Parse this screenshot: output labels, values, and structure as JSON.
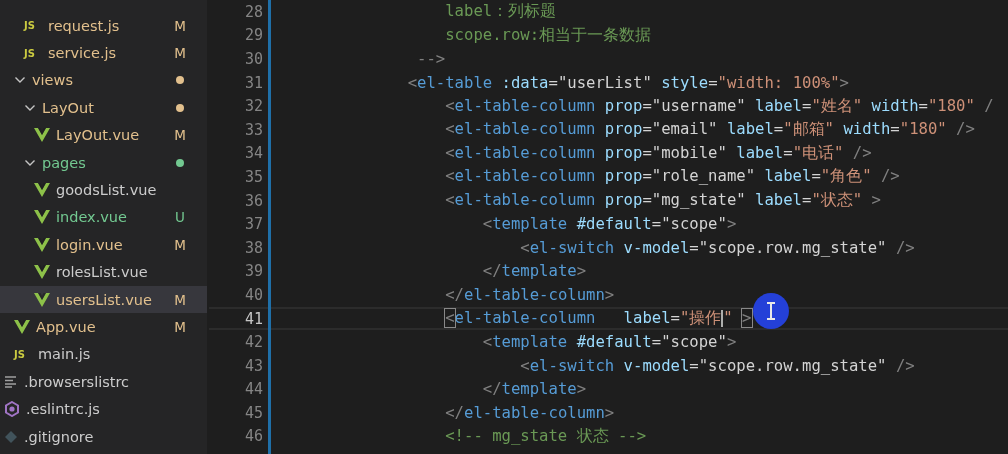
{
  "explorer": {
    "items": [
      {
        "children": [
          {
            "children": [
              {
                "name": "request.js",
                "kind": "js",
                "icon_label": "JS",
                "color": "#e2c08d",
                "badge": "M",
                "selected": false
              },
              {
                "name": "service.js",
                "kind": "js",
                "icon_label": "JS",
                "color": "#e2c08d",
                "badge": "M",
                "selected": false
              }
            ]
          },
          {
            "name": "views",
            "kind": "folder",
            "color": "#e2c08d",
            "expanded": true,
            "selected": false,
            "children": [
              {
                "name": "LayOut",
                "kind": "folder",
                "color": "#e2c08d",
                "expanded": true,
                "selected": false,
                "children": [
                  {
                    "name": "LayOut.vue",
                    "kind": "vue",
                    "color": "#e2c08d",
                    "badge": "M",
                    "selected": false
                  }
                ]
              },
              {
                "name": "pages",
                "kind": "folder",
                "color": "#73c991",
                "expanded": true,
                "selected": false,
                "children": [
                  {
                    "name": "goodsList.vue",
                    "kind": "vue",
                    "selected": false
                  },
                  {
                    "name": "index.vue",
                    "kind": "vue",
                    "color": "#73c991",
                    "badge": "U",
                    "selected": false
                  },
                  {
                    "name": "login.vue",
                    "kind": "vue",
                    "color": "#e2c08d",
                    "badge": "M",
                    "selected": false
                  },
                  {
                    "name": "rolesList.vue",
                    "kind": "vue",
                    "selected": false
                  },
                  {
                    "name": "usersList.vue",
                    "kind": "vue",
                    "color": "#e2c08d",
                    "badge": "M",
                    "selected": true
                  }
                ]
              }
            ]
          },
          {
            "name": "App.vue",
            "kind": "vue",
            "color": "#e2c08d",
            "badge": "M",
            "selected": false
          },
          {
            "name": "main.js",
            "kind": "js",
            "icon_label": "JS",
            "selected": false
          }
        ]
      },
      {
        "name": ".browserslistrc",
        "kind": "config",
        "selected": false
      },
      {
        "name": ".eslintrc.js",
        "kind": "eslint",
        "selected": false
      },
      {
        "name": ".gitignore",
        "kind": "git",
        "selected": false
      }
    ]
  },
  "editor": {
    "lines": [
      {
        "number": "28",
        "current": false,
        "tokens": [
          {
            "kind": "comment",
            "text": "                label：列标题"
          }
        ]
      },
      {
        "number": "29",
        "current": false,
        "tokens": [
          {
            "kind": "comment",
            "text": "                scope.row:相当于一条数据"
          }
        ]
      },
      {
        "number": "30",
        "current": false,
        "tokens": [
          {
            "kind": "punct",
            "text": "             -->"
          }
        ]
      },
      {
        "number": "31",
        "current": false,
        "tokens": [
          {
            "kind": "punct",
            "text": "            <"
          },
          {
            "kind": "tag",
            "text": "el-table"
          },
          {
            "kind": "attr",
            "text": " :data"
          },
          {
            "kind": "plain",
            "text": "=\"userList\" "
          },
          {
            "kind": "attr",
            "text": "style"
          },
          {
            "kind": "plain",
            "text": "="
          },
          {
            "kind": "string",
            "text": "\"width: 100%\""
          },
          {
            "kind": "punct",
            "text": ">"
          }
        ]
      },
      {
        "number": "32",
        "current": false,
        "tokens": [
          {
            "kind": "punct",
            "text": "                <"
          },
          {
            "kind": "tag",
            "text": "el-table-column"
          },
          {
            "kind": "attr",
            "text": " prop"
          },
          {
            "kind": "plain",
            "text": "=\"username\" "
          },
          {
            "kind": "attr",
            "text": "label"
          },
          {
            "kind": "plain",
            "text": "="
          },
          {
            "kind": "string",
            "text": "\"姓名\""
          },
          {
            "kind": "attr",
            "text": " width"
          },
          {
            "kind": "plain",
            "text": "="
          },
          {
            "kind": "string",
            "text": "\"180\""
          },
          {
            "kind": "punct",
            "text": " /"
          }
        ]
      },
      {
        "number": "33",
        "current": false,
        "tokens": [
          {
            "kind": "punct",
            "text": "                <"
          },
          {
            "kind": "tag",
            "text": "el-table-column"
          },
          {
            "kind": "attr",
            "text": " prop"
          },
          {
            "kind": "plain",
            "text": "=\"email\" "
          },
          {
            "kind": "attr",
            "text": "label"
          },
          {
            "kind": "plain",
            "text": "="
          },
          {
            "kind": "string",
            "text": "\"邮箱\""
          },
          {
            "kind": "attr",
            "text": " width"
          },
          {
            "kind": "plain",
            "text": "="
          },
          {
            "kind": "string",
            "text": "\"180\""
          },
          {
            "kind": "punct",
            "text": " />"
          }
        ]
      },
      {
        "number": "34",
        "current": false,
        "tokens": [
          {
            "kind": "punct",
            "text": "                <"
          },
          {
            "kind": "tag",
            "text": "el-table-column"
          },
          {
            "kind": "attr",
            "text": " prop"
          },
          {
            "kind": "plain",
            "text": "=\"mobile\" "
          },
          {
            "kind": "attr",
            "text": "label"
          },
          {
            "kind": "plain",
            "text": "="
          },
          {
            "kind": "string",
            "text": "\"电话\""
          },
          {
            "kind": "punct",
            "text": " />"
          }
        ]
      },
      {
        "number": "35",
        "current": false,
        "tokens": [
          {
            "kind": "punct",
            "text": "                <"
          },
          {
            "kind": "tag",
            "text": "el-table-column"
          },
          {
            "kind": "attr",
            "text": " prop"
          },
          {
            "kind": "plain",
            "text": "=\"role_name\" "
          },
          {
            "kind": "attr",
            "text": "label"
          },
          {
            "kind": "plain",
            "text": "="
          },
          {
            "kind": "string",
            "text": "\"角色\""
          },
          {
            "kind": "punct",
            "text": " />"
          }
        ]
      },
      {
        "number": "36",
        "current": false,
        "tokens": [
          {
            "kind": "punct",
            "text": "                <"
          },
          {
            "kind": "tag",
            "text": "el-table-column"
          },
          {
            "kind": "attr",
            "text": " prop"
          },
          {
            "kind": "plain",
            "text": "=\"mg_state\" "
          },
          {
            "kind": "attr",
            "text": "label"
          },
          {
            "kind": "plain",
            "text": "="
          },
          {
            "kind": "string",
            "text": "\"状态\""
          },
          {
            "kind": "punct",
            "text": " >"
          }
        ]
      },
      {
        "number": "37",
        "current": false,
        "tokens": [
          {
            "kind": "punct",
            "text": "                    <"
          },
          {
            "kind": "tag",
            "text": "template"
          },
          {
            "kind": "attr",
            "text": " #default"
          },
          {
            "kind": "plain",
            "text": "=\"scope\""
          },
          {
            "kind": "punct",
            "text": ">"
          }
        ]
      },
      {
        "number": "38",
        "current": false,
        "tokens": [
          {
            "kind": "punct",
            "text": "                        <"
          },
          {
            "kind": "tag",
            "text": "el-switch"
          },
          {
            "kind": "attr",
            "text": " v-model"
          },
          {
            "kind": "plain",
            "text": "=\"scope.row.mg_state\" "
          },
          {
            "kind": "punct",
            "text": "/>"
          }
        ]
      },
      {
        "number": "39",
        "current": false,
        "tokens": [
          {
            "kind": "punct",
            "text": "                    </"
          },
          {
            "kind": "tag",
            "text": "template"
          },
          {
            "kind": "punct",
            "text": ">"
          }
        ]
      },
      {
        "number": "40",
        "current": false,
        "tokens": [
          {
            "kind": "punct",
            "text": "                </"
          },
          {
            "kind": "tag",
            "text": "el-table-column"
          },
          {
            "kind": "punct",
            "text": ">"
          }
        ]
      },
      {
        "number": "41",
        "current": true,
        "tokens": [
          {
            "kind": "punct",
            "text": "                <",
            "matched": true
          },
          {
            "kind": "tag",
            "text": "el-table-column"
          },
          {
            "kind": "attr",
            "text": "   label"
          },
          {
            "kind": "plain",
            "text": "="
          },
          {
            "kind": "string",
            "text": "\"操作"
          },
          {
            "kind": "cursor"
          },
          {
            "kind": "string",
            "text": "\" "
          },
          {
            "kind": "punct",
            "text": ">",
            "matched": true
          }
        ]
      },
      {
        "number": "42",
        "current": false,
        "tokens": [
          {
            "kind": "punct",
            "text": "                    <"
          },
          {
            "kind": "tag",
            "text": "template"
          },
          {
            "kind": "attr",
            "text": " #default"
          },
          {
            "kind": "plain",
            "text": "=\"scope\""
          },
          {
            "kind": "punct",
            "text": ">"
          }
        ]
      },
      {
        "number": "43",
        "current": false,
        "tokens": [
          {
            "kind": "punct",
            "text": "                        <"
          },
          {
            "kind": "tag",
            "text": "el-switch"
          },
          {
            "kind": "attr",
            "text": " v-model"
          },
          {
            "kind": "plain",
            "text": "=\"scope.row.mg_state\" "
          },
          {
            "kind": "punct",
            "text": "/>"
          }
        ]
      },
      {
        "number": "44",
        "current": false,
        "tokens": [
          {
            "kind": "punct",
            "text": "                    </"
          },
          {
            "kind": "tag",
            "text": "template"
          },
          {
            "kind": "punct",
            "text": ">"
          }
        ]
      },
      {
        "number": "45",
        "current": false,
        "tokens": [
          {
            "kind": "punct",
            "text": "                </"
          },
          {
            "kind": "tag",
            "text": "el-table-column"
          },
          {
            "kind": "punct",
            "text": ">"
          }
        ]
      },
      {
        "number": "46",
        "current": false,
        "tokens": [
          {
            "kind": "comment",
            "text": "                <!-- mg_state 状态 -->"
          }
        ]
      }
    ]
  }
}
